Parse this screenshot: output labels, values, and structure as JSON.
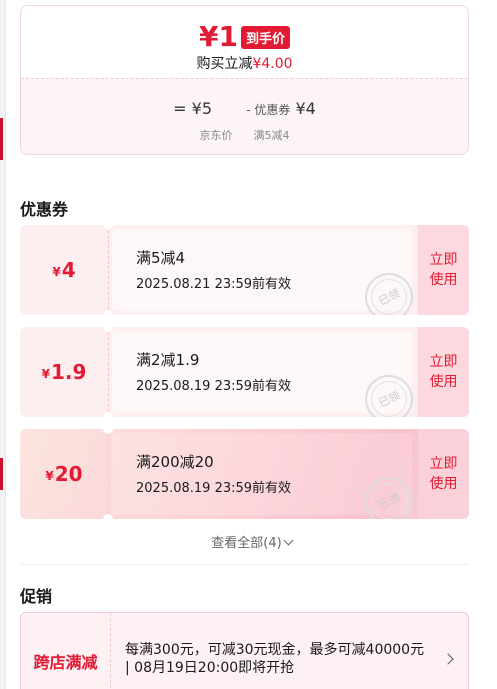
{
  "price_summary": {
    "currency": "¥",
    "final_price": "1",
    "final_tag": "到手价",
    "saving_prefix": "购买立减",
    "saving_amount": "¥4.00",
    "formula_base": "= ¥5",
    "formula_minus_label": "- 优惠券",
    "formula_minus_value": "¥4",
    "label_base": "京东价",
    "label_coupon": "满5减4"
  },
  "coupons_section": {
    "title": "优惠券",
    "view_all": "查看全部(4)",
    "coupons": [
      {
        "currency": "¥",
        "amount": "4",
        "condition": "满5减4",
        "validity": "2025.08.21 23:59前有效",
        "action": "立即使用",
        "stamp": "已领"
      },
      {
        "currency": "¥",
        "amount": "1.9",
        "condition": "满2减1.9",
        "validity": "2025.08.19 23:59前有效",
        "action": "立即使用",
        "stamp": "已领"
      },
      {
        "currency": "¥",
        "amount": "20",
        "condition": "满200减20",
        "validity": "2025.08.19 23:59前有效",
        "action": "立即使用",
        "stamp": "已领"
      }
    ]
  },
  "promotions_section": {
    "title": "促销",
    "items": [
      {
        "type": "跨店满减",
        "description": "每满300元，可减30元现金，最多可减40000元 | 08月19日20:00即将开抢"
      }
    ]
  },
  "colors": {
    "accent": "#e21a33",
    "coupon_bg": "#fdeef0",
    "use_button_bg": "#fbd9de"
  }
}
